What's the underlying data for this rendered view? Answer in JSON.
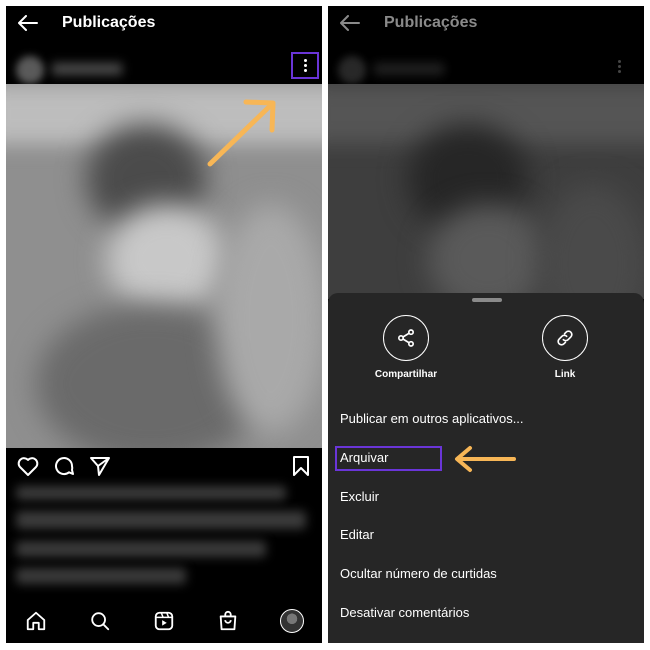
{
  "left": {
    "title": "Publicações"
  },
  "right": {
    "title": "Publicações",
    "share_label": "Compartilhar",
    "link_label": "Link",
    "menu": [
      "Publicar em outros aplicativos...",
      "Arquivar",
      "Excluir",
      "Editar",
      "Ocultar número de curtidas",
      "Desativar comentários"
    ]
  },
  "colors": {
    "highlight": "#6a35d8",
    "arrow": "#f7b656",
    "sheet": "#262626"
  },
  "icons": [
    "back-arrow-icon",
    "more-vertical-icon",
    "heart-icon",
    "comment-icon",
    "send-icon",
    "bookmark-icon",
    "home-icon",
    "search-icon",
    "reels-icon",
    "shop-icon",
    "share-icon",
    "link-icon"
  ]
}
